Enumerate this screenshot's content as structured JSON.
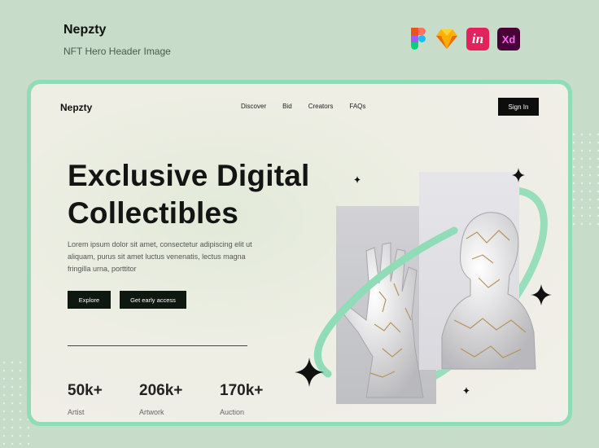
{
  "meta": {
    "title": "Nepzty",
    "subtitle": "NFT Hero Header Image"
  },
  "tools": [
    {
      "icon": "figma-icon",
      "label": ""
    },
    {
      "icon": "sketch-icon",
      "label": ""
    },
    {
      "icon": "invision-icon",
      "label": "in"
    },
    {
      "icon": "adobe-xd-icon",
      "label": "Xd"
    }
  ],
  "nav": {
    "logo": "Nepzty",
    "links": [
      "Discover",
      "Bid",
      "Creators",
      "FAQs"
    ],
    "signin": "Sign In"
  },
  "hero": {
    "headline_line1": "Exclusive Digital",
    "headline_line2": "Collectibles",
    "description": "Lorem ipsum dolor sit amet, consectetur adipiscing elit ut aliquam, purus sit amet luctus venenatis, lectus magna fringilla urna, porttitor",
    "explore": "Explore",
    "early_access": "Get early access"
  },
  "stats": [
    {
      "value": "50k+",
      "label": "Artist"
    },
    {
      "value": "206k+",
      "label": "Artwork"
    },
    {
      "value": "170k+",
      "label": "Auction"
    }
  ],
  "colors": {
    "background": "#c7dcc9",
    "accent": "#8fdcb6",
    "button": "#0f1711"
  }
}
